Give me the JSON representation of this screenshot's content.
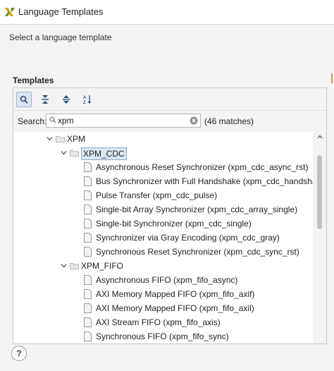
{
  "window": {
    "title": "Language Templates",
    "subtitle": "Select a language template"
  },
  "templates": {
    "section_label": "Templates",
    "toolbar": [
      {
        "name": "search-icon",
        "active": true
      },
      {
        "name": "collapse-all-icon",
        "active": false
      },
      {
        "name": "expand-all-icon",
        "active": false
      },
      {
        "name": "sort-az-icon",
        "active": false
      }
    ],
    "search": {
      "label": "Search:",
      "value": "xpm",
      "matches": "(46 matches)"
    },
    "tree": [
      {
        "label": "XPM",
        "level": 0,
        "type": "folder"
      },
      {
        "label": "XPM_CDC",
        "level": 1,
        "type": "folder",
        "selected": true
      },
      {
        "label": "Asynchronous Reset Synchronizer (xpm_cdc_async_rst)",
        "level": 2,
        "type": "file"
      },
      {
        "label": "Bus Synchronizer with Full Handshake (xpm_cdc_handshake)",
        "level": 2,
        "type": "file"
      },
      {
        "label": "Pulse Transfer (xpm_cdc_pulse)",
        "level": 2,
        "type": "file"
      },
      {
        "label": "Single-bit Array Synchronizer (xpm_cdc_array_single)",
        "level": 2,
        "type": "file"
      },
      {
        "label": "Single-bit Synchronizer (xpm_cdc_single)",
        "level": 2,
        "type": "file"
      },
      {
        "label": "Synchronizer via Gray Encoding (xpm_cdc_gray)",
        "level": 2,
        "type": "file"
      },
      {
        "label": "Synchronous Reset Synchronizer (xpm_cdc_sync_rst)",
        "level": 2,
        "type": "file"
      },
      {
        "label": "XPM_FIFO",
        "level": 1,
        "type": "folder"
      },
      {
        "label": "Asynchronous FIFO (xpm_fifo_async)",
        "level": 2,
        "type": "file"
      },
      {
        "label": "AXI Memory Mapped FIFO (xpm_fifo_axif)",
        "level": 2,
        "type": "file"
      },
      {
        "label": "AXI Memory Mapped FIFO (xpm_fifo_axil)",
        "level": 2,
        "type": "file"
      },
      {
        "label": "AXI Stream FIFO (xpm_fifo_axis)",
        "level": 2,
        "type": "file"
      },
      {
        "label": "Synchronous FIFO (xpm_fifo_sync)",
        "level": 2,
        "type": "file"
      }
    ]
  },
  "help": {
    "label": "?"
  },
  "colors": {
    "selection": "#dbe6f4",
    "folder": "#b5b5b5",
    "logo": "#d9a400"
  }
}
